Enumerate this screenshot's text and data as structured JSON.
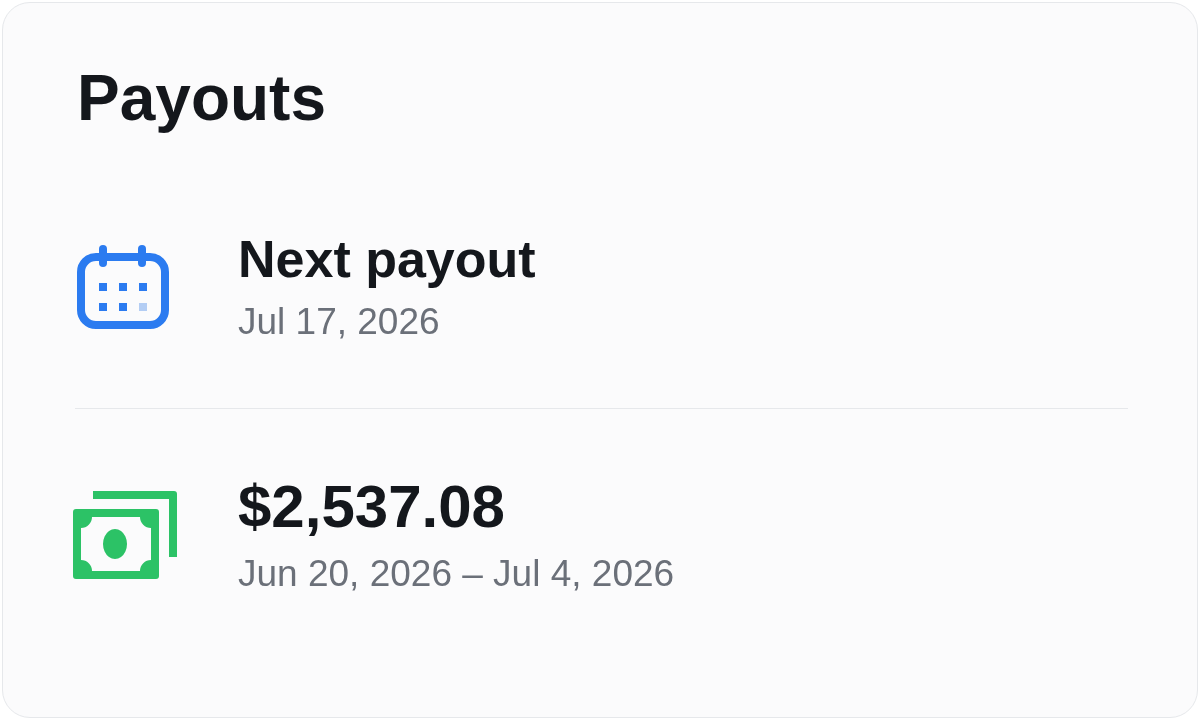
{
  "card": {
    "title": "Payouts"
  },
  "items": [
    {
      "kind": "calendar",
      "title": "Next payout",
      "subtitle": "Jul 17, 2026"
    },
    {
      "kind": "cash",
      "title": "$2,537.08",
      "subtitle": "Jun 20, 2026 – Jul 4, 2026"
    }
  ]
}
